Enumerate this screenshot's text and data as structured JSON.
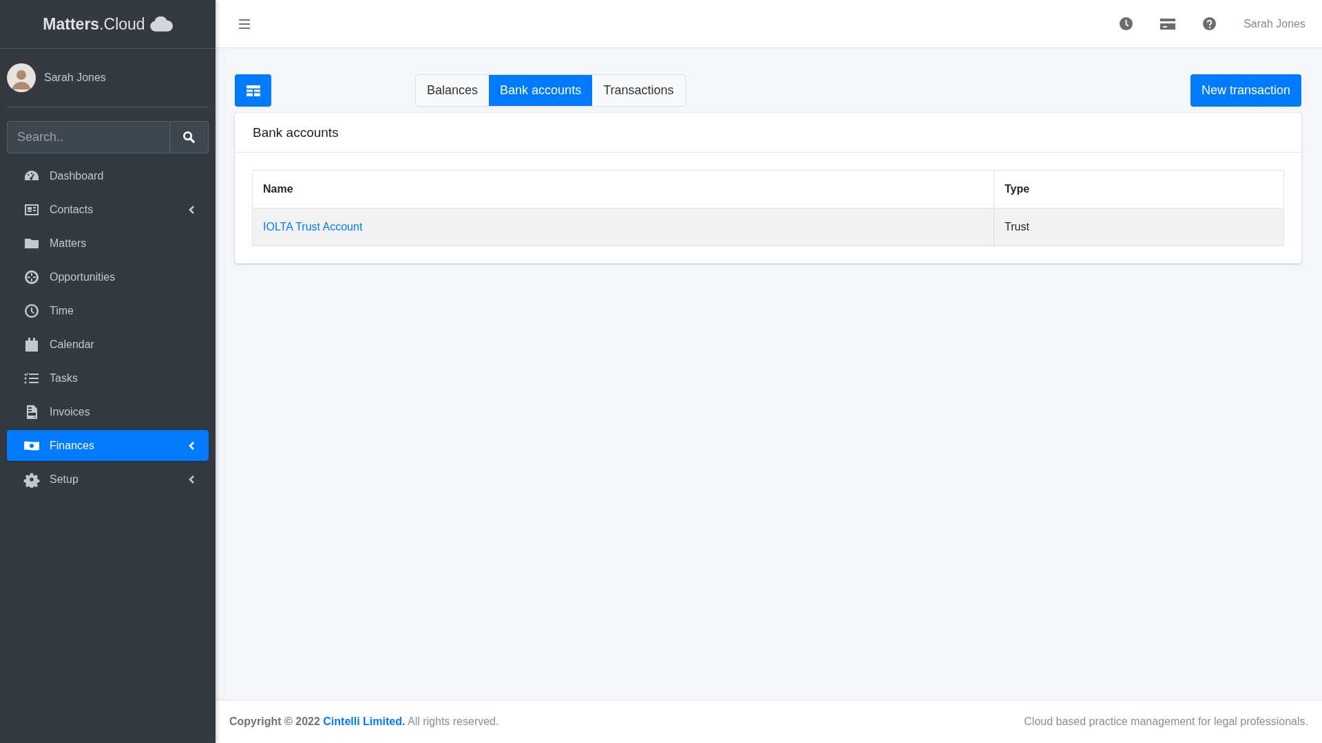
{
  "sidebar": {
    "logo": "**Matters**.Cloud",
    "user": {
      "name": "Sarah Jones"
    },
    "search": {
      "placeholder": "Search.."
    },
    "items": [
      {
        "label": "Dashboard",
        "selected": false,
        "expandable": false
      },
      {
        "label": "Contacts",
        "selected": false,
        "expandable": true
      },
      {
        "label": "Matters",
        "selected": false,
        "expandable": false
      },
      {
        "label": "Opportunities",
        "selected": false,
        "expandable": false
      },
      {
        "label": "Time",
        "selected": false,
        "expandable": false
      },
      {
        "label": "Calendar",
        "selected": false,
        "expandable": false
      },
      {
        "label": "Tasks",
        "selected": false,
        "expandable": false
      },
      {
        "label": "Invoices",
        "selected": false,
        "expandable": false
      },
      {
        "label": "Finances",
        "selected": true,
        "expandable": true
      },
      {
        "label": "Setup",
        "selected": false,
        "expandable": true
      }
    ]
  },
  "topbar": {
    "user_name": "Sarah Jones"
  },
  "tabs": [
    {
      "label": "Balances",
      "selected": false
    },
    {
      "label": "Bank accounts",
      "selected": true
    },
    {
      "label": "Transactions",
      "selected": false
    }
  ],
  "new_button": "New transaction",
  "card": {
    "title": "Bank accounts",
    "table": {
      "columns": [
        "Name",
        "Type"
      ],
      "rows": [
        {
          "name": "IOLTA Trust Account",
          "type": "Trust"
        }
      ]
    }
  },
  "footer": {
    "copyright": "Copyright © 2022",
    "company": "Cintelli Limited.",
    "rights": "All rights reserved.",
    "tagline": "Cloud based practice management for legal professionals."
  }
}
